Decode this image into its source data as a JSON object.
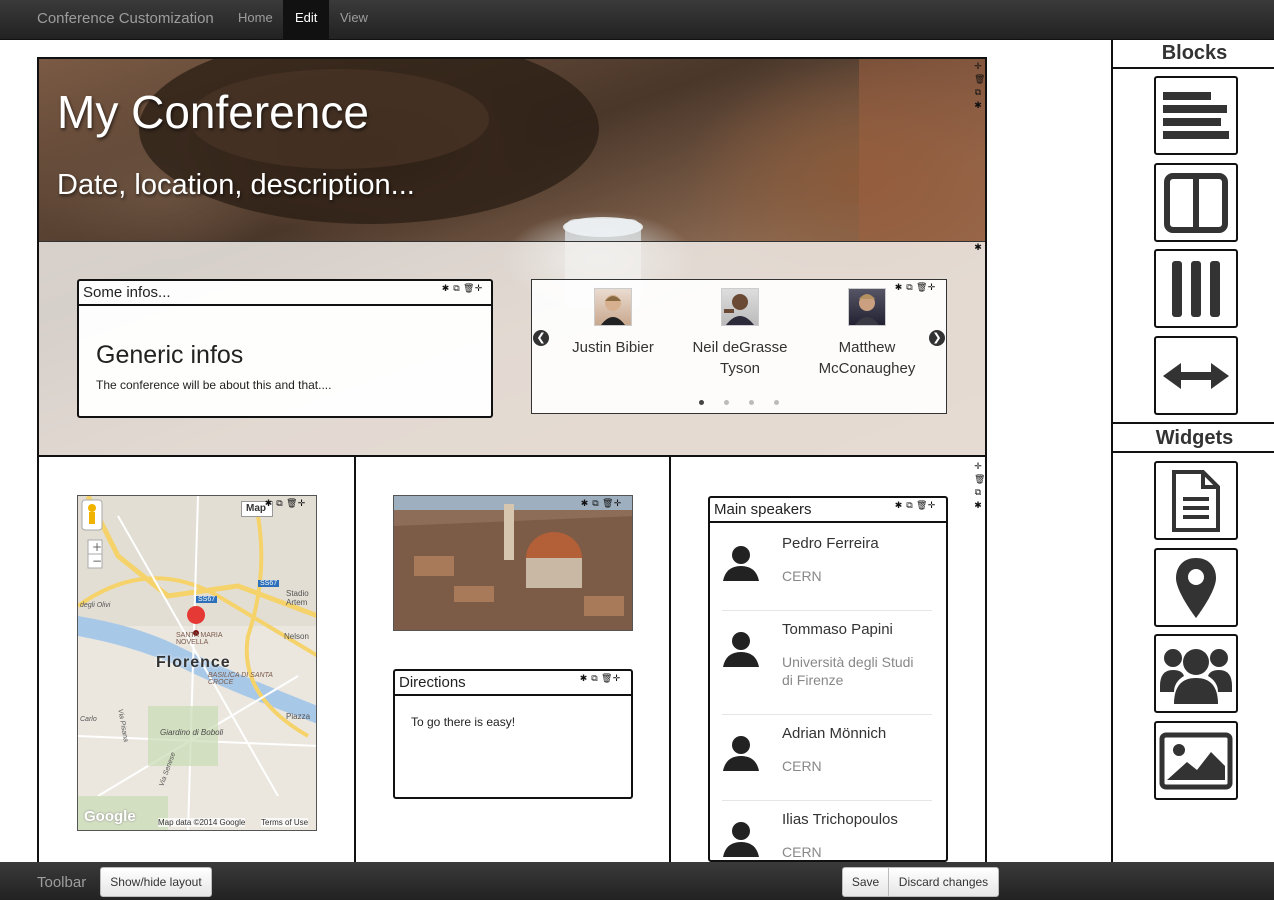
{
  "navbar": {
    "brand": "Conference Customization",
    "links": [
      {
        "label": "Home"
      },
      {
        "label": "Edit"
      },
      {
        "label": "View"
      }
    ]
  },
  "hero": {
    "title": "My Conference",
    "subtitle": "Date, location, description..."
  },
  "infos_box": {
    "header": "Some infos...",
    "title": "Generic infos",
    "text": "The conference will be about this and that...."
  },
  "carousel": {
    "people": [
      {
        "name": "Justin Bibier"
      },
      {
        "name": "Neil deGrasse Tyson"
      },
      {
        "name": "Matthew McConaughey"
      }
    ],
    "dots": 4,
    "active_dot": 1
  },
  "map": {
    "type_button": "Map",
    "city_label": "Florence",
    "labels": [
      "SANTA MARIA NOVELLA",
      "BASILICA DI SANTA CROCE",
      "Giardino di Boboli",
      "Nelson",
      "Piazza",
      "Stadio Artem",
      "SS67",
      "SS67",
      "Via Senese",
      "Carlo",
      "degli Olivi",
      "Via Pisana"
    ],
    "attribution": "Map data ©2014 Google",
    "terms": "Terms of Use",
    "logo": "Google"
  },
  "directions_box": {
    "header": "Directions",
    "text": "To go there is easy!"
  },
  "speakers_box": {
    "header": "Main speakers",
    "speakers": [
      {
        "name": "Pedro Ferreira",
        "affiliation": "CERN"
      },
      {
        "name": "Tommaso Papini",
        "affiliation": "Università degli Studi di Firenze"
      },
      {
        "name": "Adrian Mönnich",
        "affiliation": "CERN"
      },
      {
        "name": "Ilias Trichopoulos",
        "affiliation": "CERN"
      }
    ]
  },
  "sidebar": {
    "blocks_title": "Blocks",
    "widgets_title": "Widgets",
    "blocks": [
      "single-column-icon",
      "two-columns-icon",
      "three-columns-icon",
      "full-width-icon"
    ],
    "widgets": [
      "text-document-icon",
      "map-marker-icon",
      "people-icon",
      "image-icon"
    ]
  },
  "toolbar": {
    "label": "Toolbar",
    "toggle_layout": "Show/hide layout",
    "save": "Save",
    "discard": "Discard changes"
  },
  "tool_icons": {
    "settings": "✱",
    "copy": "⧉",
    "delete": "🗑",
    "move": "✛"
  }
}
